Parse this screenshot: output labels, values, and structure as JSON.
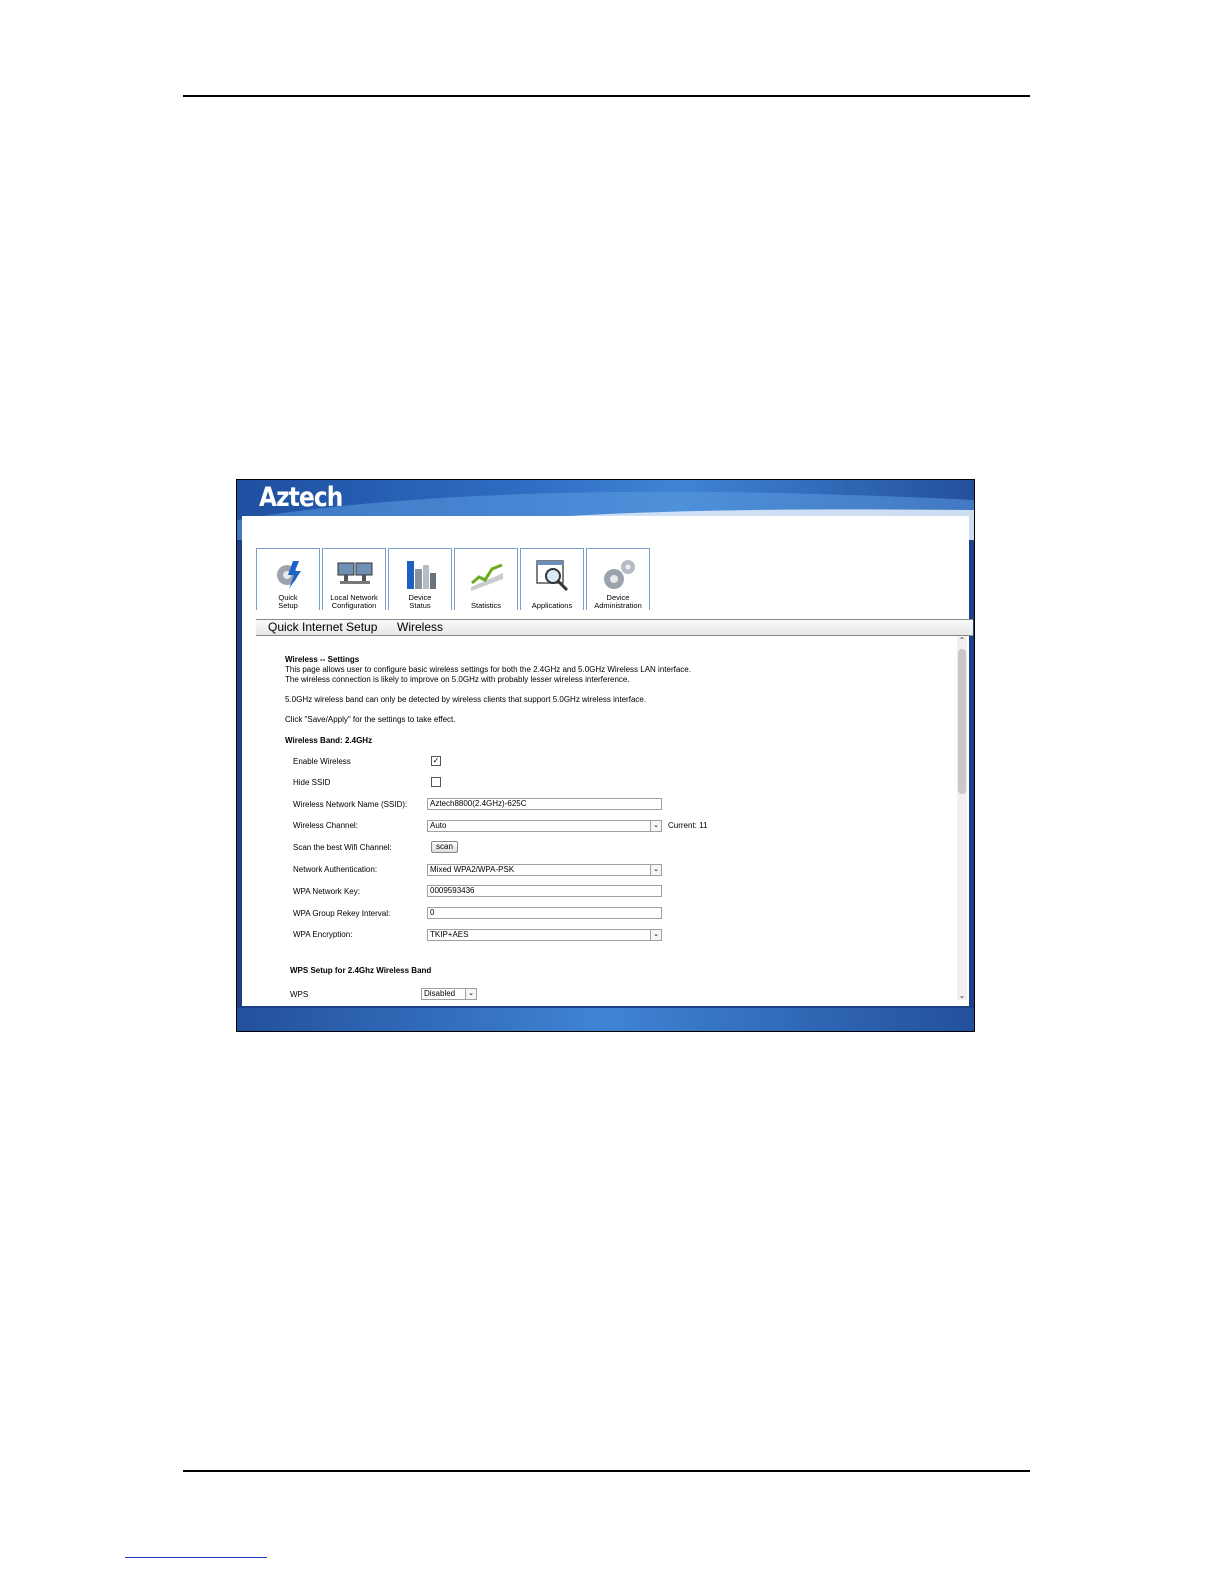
{
  "app": {
    "logo": "Aztech"
  },
  "tabs": [
    {
      "line1": "Quick",
      "line2": "Setup",
      "icon": "gear-lightning-icon"
    },
    {
      "line1": "Local Network",
      "line2": "Configuration",
      "icon": "monitors-icon"
    },
    {
      "line1": "Device",
      "line2": "Status",
      "icon": "buildings-icon"
    },
    {
      "line1": "Statistics",
      "line2": "",
      "icon": "graph-icon"
    },
    {
      "line1": "Applications",
      "line2": "",
      "icon": "magnifier-window-icon"
    },
    {
      "line1": "Device",
      "line2": "Administration",
      "icon": "gears-icon"
    }
  ],
  "breadcrumb": {
    "section": "Quick Internet Setup",
    "page": "Wireless"
  },
  "intro": {
    "title": "Wireless -- Settings",
    "line1": "This page allows user to configure basic wireless settings for both the 2.4GHz and 5.0GHz Wireless LAN interface.",
    "line2": "The wireless connection is likely to improve on 5.0GHz with probably lesser wireless interference.",
    "line3": "5.0GHz wireless band can only be detected by wireless clients that support 5.0GHz wireless interface.",
    "line4": "Click \"Save/Apply\" for the settings to take effect."
  },
  "band": {
    "heading": "Wireless Band: 2.4GHz",
    "enable_label": "Enable Wireless",
    "enable_checked": true,
    "hide_label": "Hide SSID",
    "hide_checked": false,
    "ssid_label": "Wireless Network Name (SSID):",
    "ssid_value": "Aztech8800(2.4GHz)-625C",
    "channel_label": "Wireless Channel:",
    "channel_value": "Auto",
    "channel_current": "Current: 11",
    "scan_label": "Scan the best Wifi Channel:",
    "scan_button": "scan",
    "auth_label": "Network Authentication:",
    "auth_value": "Mixed WPA2/WPA-PSK",
    "key_label": "WPA Network Key:",
    "key_value": "0009593436",
    "rekey_label": "WPA Group Rekey Interval:",
    "rekey_value": "0",
    "enc_label": "WPA Encryption:",
    "enc_value": "TKIP+AES"
  },
  "wps": {
    "heading": "WPS Setup for 2.4Ghz Wireless Band",
    "label": "WPS",
    "value": "Disabled"
  },
  "colors": {
    "banner": "#2f6ec4",
    "frame": "#1c3f86",
    "tab_border": "#7a9ed0"
  }
}
